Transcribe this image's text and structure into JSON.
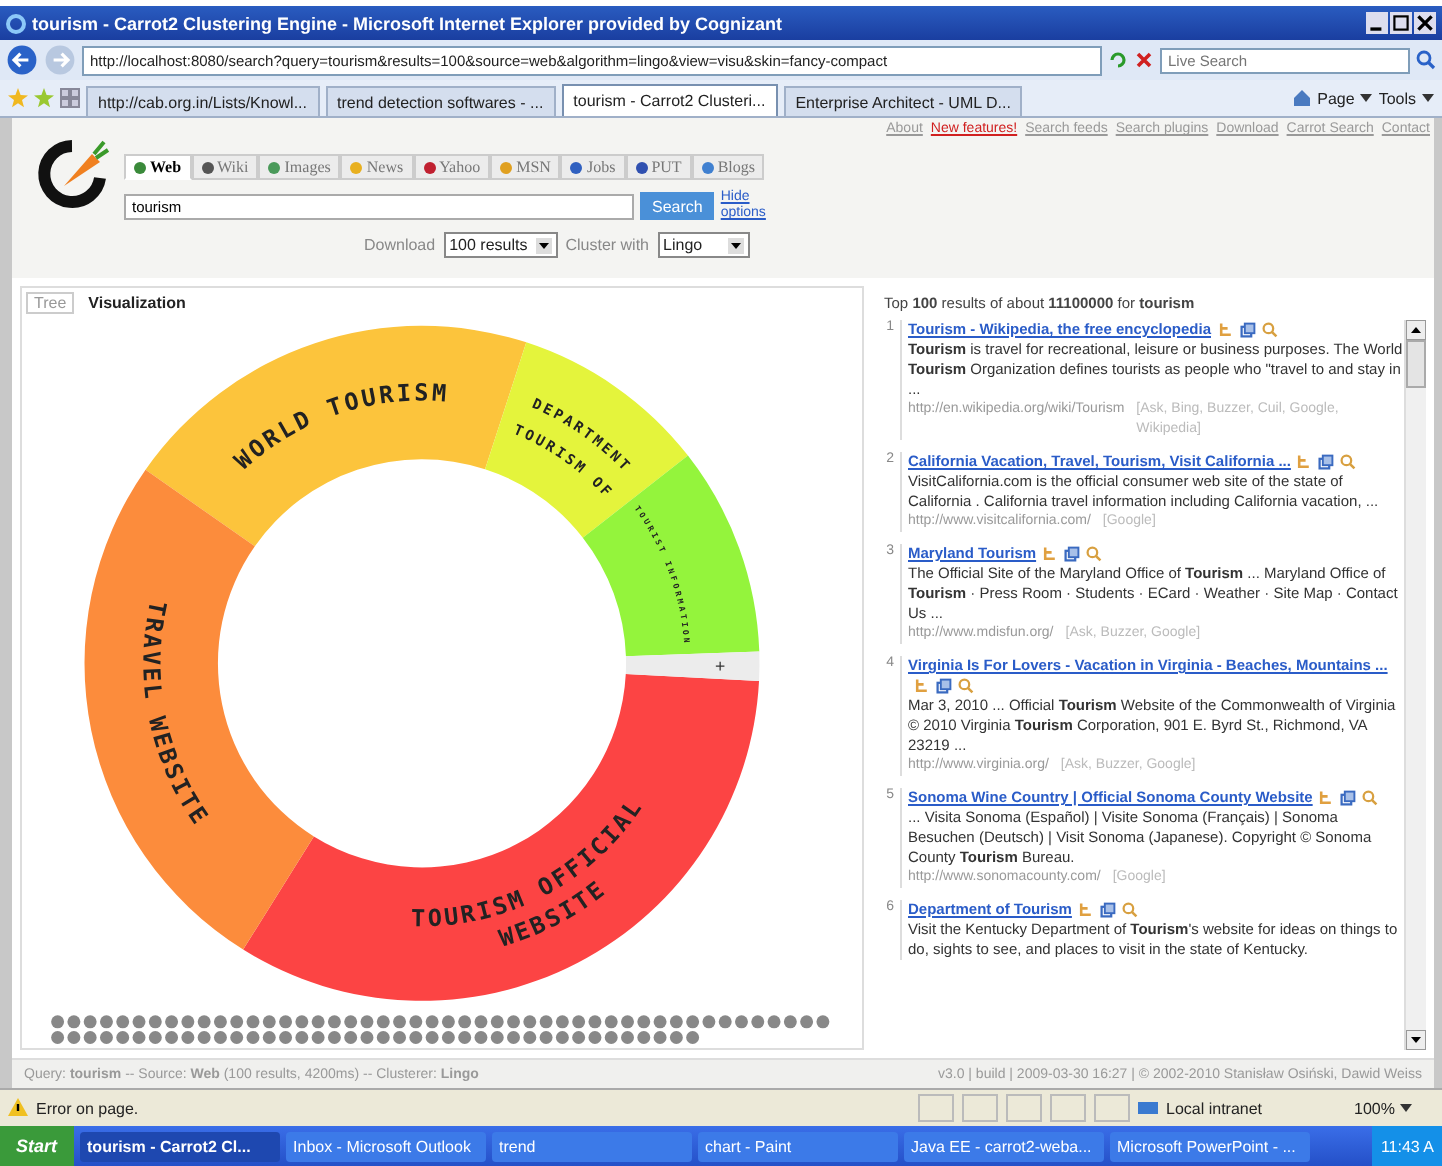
{
  "window": {
    "title": "tourism - Carrot2 Clustering Engine - Microsoft Internet Explorer provided by Cognizant"
  },
  "address_bar": {
    "url": "http://localhost:8080/search?query=tourism&results=100&source=web&algorithm=lingo&view=visu&skin=fancy-compact",
    "search_placeholder": "Live Search"
  },
  "browser_tabs": [
    {
      "label": "http://cab.org.in/Lists/Knowl...",
      "selected": false
    },
    {
      "label": "trend detection softwares - ...",
      "selected": false
    },
    {
      "label": "tourism - Carrot2 Clusteri...",
      "selected": true
    },
    {
      "label": "Enterprise Architect - UML D...",
      "selected": false
    }
  ],
  "browser_tools": [
    "Page",
    "Tools"
  ],
  "top_links": [
    {
      "label": "About",
      "highlight": false
    },
    {
      "label": "New features!",
      "highlight": true
    },
    {
      "label": "Search feeds",
      "highlight": false
    },
    {
      "label": "Search plugins",
      "highlight": false
    },
    {
      "label": "Download",
      "highlight": false
    },
    {
      "label": "Carrot Search",
      "highlight": false
    },
    {
      "label": "Contact",
      "highlight": false
    }
  ],
  "sources": [
    {
      "label": "Web",
      "selected": true,
      "color": "#3a8a3a"
    },
    {
      "label": "Wiki",
      "selected": false,
      "color": "#555555"
    },
    {
      "label": "Images",
      "selected": false,
      "color": "#4a9a5a"
    },
    {
      "label": "News",
      "selected": false,
      "color": "#e8b020"
    },
    {
      "label": "Yahoo",
      "selected": false,
      "color": "#c02030"
    },
    {
      "label": "MSN",
      "selected": false,
      "color": "#e0a020"
    },
    {
      "label": "Jobs",
      "selected": false,
      "color": "#3060c0"
    },
    {
      "label": "PUT",
      "selected": false,
      "color": "#3050b0"
    },
    {
      "label": "Blogs",
      "selected": false,
      "color": "#4080d0"
    }
  ],
  "search": {
    "value": "tourism",
    "button": "Search",
    "hide_options": "Hide options"
  },
  "options": {
    "download_label": "Download",
    "download_value": "100 results",
    "cluster_label": "Cluster with",
    "cluster_value": "Lingo"
  },
  "view_tabs": [
    {
      "label": "Tree",
      "selected": false
    },
    {
      "label": "Visualization",
      "selected": true
    }
  ],
  "clusters": [
    {
      "lines": [
        "WORLD TOURISM"
      ],
      "color": "#fcc43c"
    },
    {
      "lines": [
        "DEPARTMENT",
        "TOURISM OF"
      ],
      "color": "#e4f43c"
    },
    {
      "lines": [
        "TOURIST INFORMATION"
      ],
      "color": "#94f43c"
    },
    {
      "lines": [
        "TOURISM OFFICIAL",
        "WEBSITE"
      ],
      "color": "#fc4444"
    },
    {
      "lines": [
        "TRAVEL WEBSITE"
      ],
      "color": "#fc8c3c"
    }
  ],
  "more_marker": "+",
  "results_header": "Top **100** results of about **11100000** for **tourism**",
  "results": [
    {
      "number": "1",
      "title": "Tourism - Wikipedia, the free encyclopedia",
      "snippet": "**Tourism** is travel for recreational, leisure or business purposes. The World **Tourism** Organization defines tourists as people who \"travel to and stay in ...",
      "url": "http://en.wikipedia.org/wiki/Tourism",
      "sources": "[Ask, Bing, Buzzer, Cuil, Google, Wikipedia]"
    },
    {
      "number": "2",
      "title": "California Vacation, Travel, Tourism, Visit California ...",
      "snippet": "VisitCalifornia.com is the official consumer web site of the state of California . California travel information including California vacation, ...",
      "url": "http://www.visitcalifornia.com/",
      "sources": "[Google]"
    },
    {
      "number": "3",
      "title": "Maryland Tourism",
      "snippet": "The Official Site of the Maryland Office of **Tourism** ... Maryland Office of **Tourism** · Press Room · Students · ECard · Weather · Site Map · Contact Us ...",
      "url": "http://www.mdisfun.org/",
      "sources": "[Ask, Buzzer, Google]"
    },
    {
      "number": "4",
      "title": "Virginia Is For Lovers - Vacation in Virginia - Beaches, Mountains ...",
      "snippet": "Mar 3, 2010 ... Official **Tourism** Website of the Commonwealth of Virginia © 2010 Virginia **Tourism** Corporation, 901 E. Byrd St., Richmond, VA 23219 ...",
      "url": "http://www.virginia.org/",
      "sources": "[Ask, Buzzer, Google]"
    },
    {
      "number": "5",
      "title": "Sonoma Wine Country | Official Sonoma County Website",
      "snippet": "... Visita Sonoma (Español) | Visite Sonoma (Français) | Sonoma Besuchen (Deutsch) | Visit Sonoma (Japanese). Copyright © Sonoma County **Tourism** Bureau.",
      "url": "http://www.sonomacounty.com/",
      "sources": "[Google]"
    },
    {
      "number": "6",
      "title": "Department of Tourism",
      "snippet": "Visit the Kentucky Department of **Tourism**'s website for ideas on things to do, sights to see, and places to visit in the state of Kentucky."
    }
  ],
  "footer": {
    "query": "Query: **tourism** -- Source: **Web** (100 results, 4200ms) -- Clusterer: **Lingo**",
    "version": "v3.0 | build | 2009-03-30 16:27 | © 2002-2010 Stanisław Osiński, Dawid Weiss"
  },
  "status_bar": {
    "message": "Error on page.",
    "zone": "Local intranet",
    "zoom": "100%"
  },
  "taskbar": {
    "start": "Start",
    "items": [
      {
        "label": "tourism - Carrot2 Cl...",
        "selected": true
      },
      {
        "label": "Inbox - Microsoft Outlook",
        "selected": false
      },
      {
        "label": "trend",
        "selected": false
      },
      {
        "label": "chart - Paint",
        "selected": false
      },
      {
        "label": "Java EE - carrot2-weba...",
        "selected": false
      },
      {
        "label": "Microsoft PowerPoint - ...",
        "selected": false
      }
    ],
    "clock": "11:43 A"
  }
}
